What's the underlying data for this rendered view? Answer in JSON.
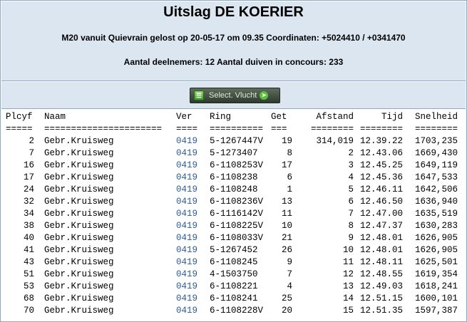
{
  "header": {
    "title": "Uitslag DE KOERIER",
    "flight_info": "M20 vanuit Quievrain gelost op 20-05-17 om 09.35 Coordinaten: +5024410 / +0341470",
    "participants": "Aantal deelnemers: 12 Aantal duiven in concours: 233"
  },
  "toolbar": {
    "select_label": "Select. Vlucht"
  },
  "table": {
    "columns": [
      "Plcyf",
      "Naam",
      "Ver",
      "Ring",
      "Get",
      "Afstand",
      "Tijd",
      "Snelheid"
    ],
    "underlines": [
      "=====",
      "======================",
      "====",
      "==========",
      "===",
      "========",
      "========",
      "========"
    ],
    "rows": [
      [
        "2",
        "Gebr.Kruisweg",
        "0419",
        "5-1267447V",
        "19",
        "314,019",
        "12.39.22",
        "1703,235"
      ],
      [
        "7",
        "Gebr.Kruisweg",
        "0419",
        "5-1273407",
        "8",
        "2",
        "12.43.06",
        "1669,430"
      ],
      [
        "16",
        "Gebr.Kruisweg",
        "0419",
        "6-1108253V",
        "17",
        "3",
        "12.45.25",
        "1649,119"
      ],
      [
        "17",
        "Gebr.Kruisweg",
        "0419",
        "6-1108238",
        "6",
        "4",
        "12.45.36",
        "1647,533"
      ],
      [
        "24",
        "Gebr.Kruisweg",
        "0419",
        "6-1108248",
        "1",
        "5",
        "12.46.11",
        "1642,506"
      ],
      [
        "32",
        "Gebr.Kruisweg",
        "0419",
        "6-1108236V",
        "13",
        "6",
        "12.46.50",
        "1636,940"
      ],
      [
        "34",
        "Gebr.Kruisweg",
        "0419",
        "6-1116142V",
        "11",
        "7",
        "12.47.00",
        "1635,519"
      ],
      [
        "38",
        "Gebr.Kruisweg",
        "0419",
        "6-1108225V",
        "10",
        "8",
        "12.47.37",
        "1630,283"
      ],
      [
        "40",
        "Gebr.Kruisweg",
        "0419",
        "6-1108033V",
        "21",
        "9",
        "12.48.01",
        "1626,905"
      ],
      [
        "41",
        "Gebr.Kruisweg",
        "0419",
        "5-1267452",
        "26",
        "10",
        "12.48.01",
        "1626,905"
      ],
      [
        "43",
        "Gebr.Kruisweg",
        "0419",
        "6-1108245",
        "9",
        "11",
        "12.48.11",
        "1625,501"
      ],
      [
        "51",
        "Gebr.Kruisweg",
        "0419",
        "4-1503750",
        "7",
        "12",
        "12.48.55",
        "1619,354"
      ],
      [
        "53",
        "Gebr.Kruisweg",
        "0419",
        "6-1108221",
        "4",
        "13",
        "12.49.03",
        "1618,241"
      ],
      [
        "68",
        "Gebr.Kruisweg",
        "0419",
        "6-1108241",
        "25",
        "14",
        "12.51.15",
        "1600,101"
      ],
      [
        "70",
        "Gebr.Kruisweg",
        "0419",
        "6-1108228V",
        "20",
        "15",
        "12.51.35",
        "1597,387"
      ]
    ]
  }
}
